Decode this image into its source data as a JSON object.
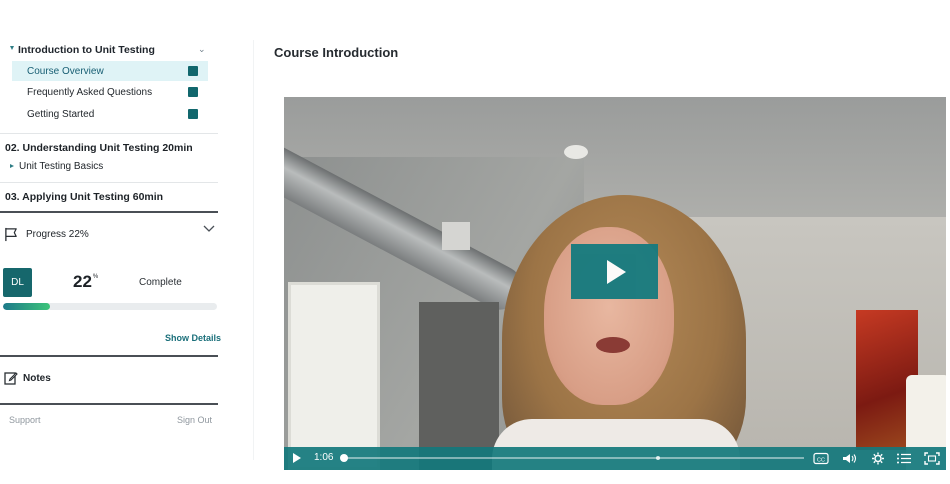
{
  "sidebar": {
    "module_intro": {
      "title": "Introduction to Unit Testing",
      "lessons": [
        {
          "label": "Course Overview",
          "active": true,
          "completed": true
        },
        {
          "label": "Frequently Asked Questions",
          "active": false,
          "completed": true
        },
        {
          "label": "Getting Started",
          "active": false,
          "completed": true
        }
      ]
    },
    "sections": [
      {
        "title": "02. Understanding Unit Testing 20min",
        "sub": "Unit Testing Basics"
      },
      {
        "title": "03. Applying Unit Testing 60min"
      }
    ],
    "progress": {
      "label": "Progress 22%",
      "avatar_initials": "DL",
      "percent_value": "22",
      "percent_sign": "%",
      "complete_label": "Complete",
      "fraction": 0.22,
      "show_details": "Show Details"
    },
    "notes_label": "Notes",
    "footer": {
      "support": "Support",
      "sign_out": "Sign Out"
    }
  },
  "content": {
    "title": "Course Introduction",
    "video": {
      "current_time": "1:06",
      "played_fraction": 0.0
    }
  },
  "colors": {
    "accent": "#11676d",
    "active_row": "#dff3f6",
    "controls_bar": "#14787c"
  }
}
